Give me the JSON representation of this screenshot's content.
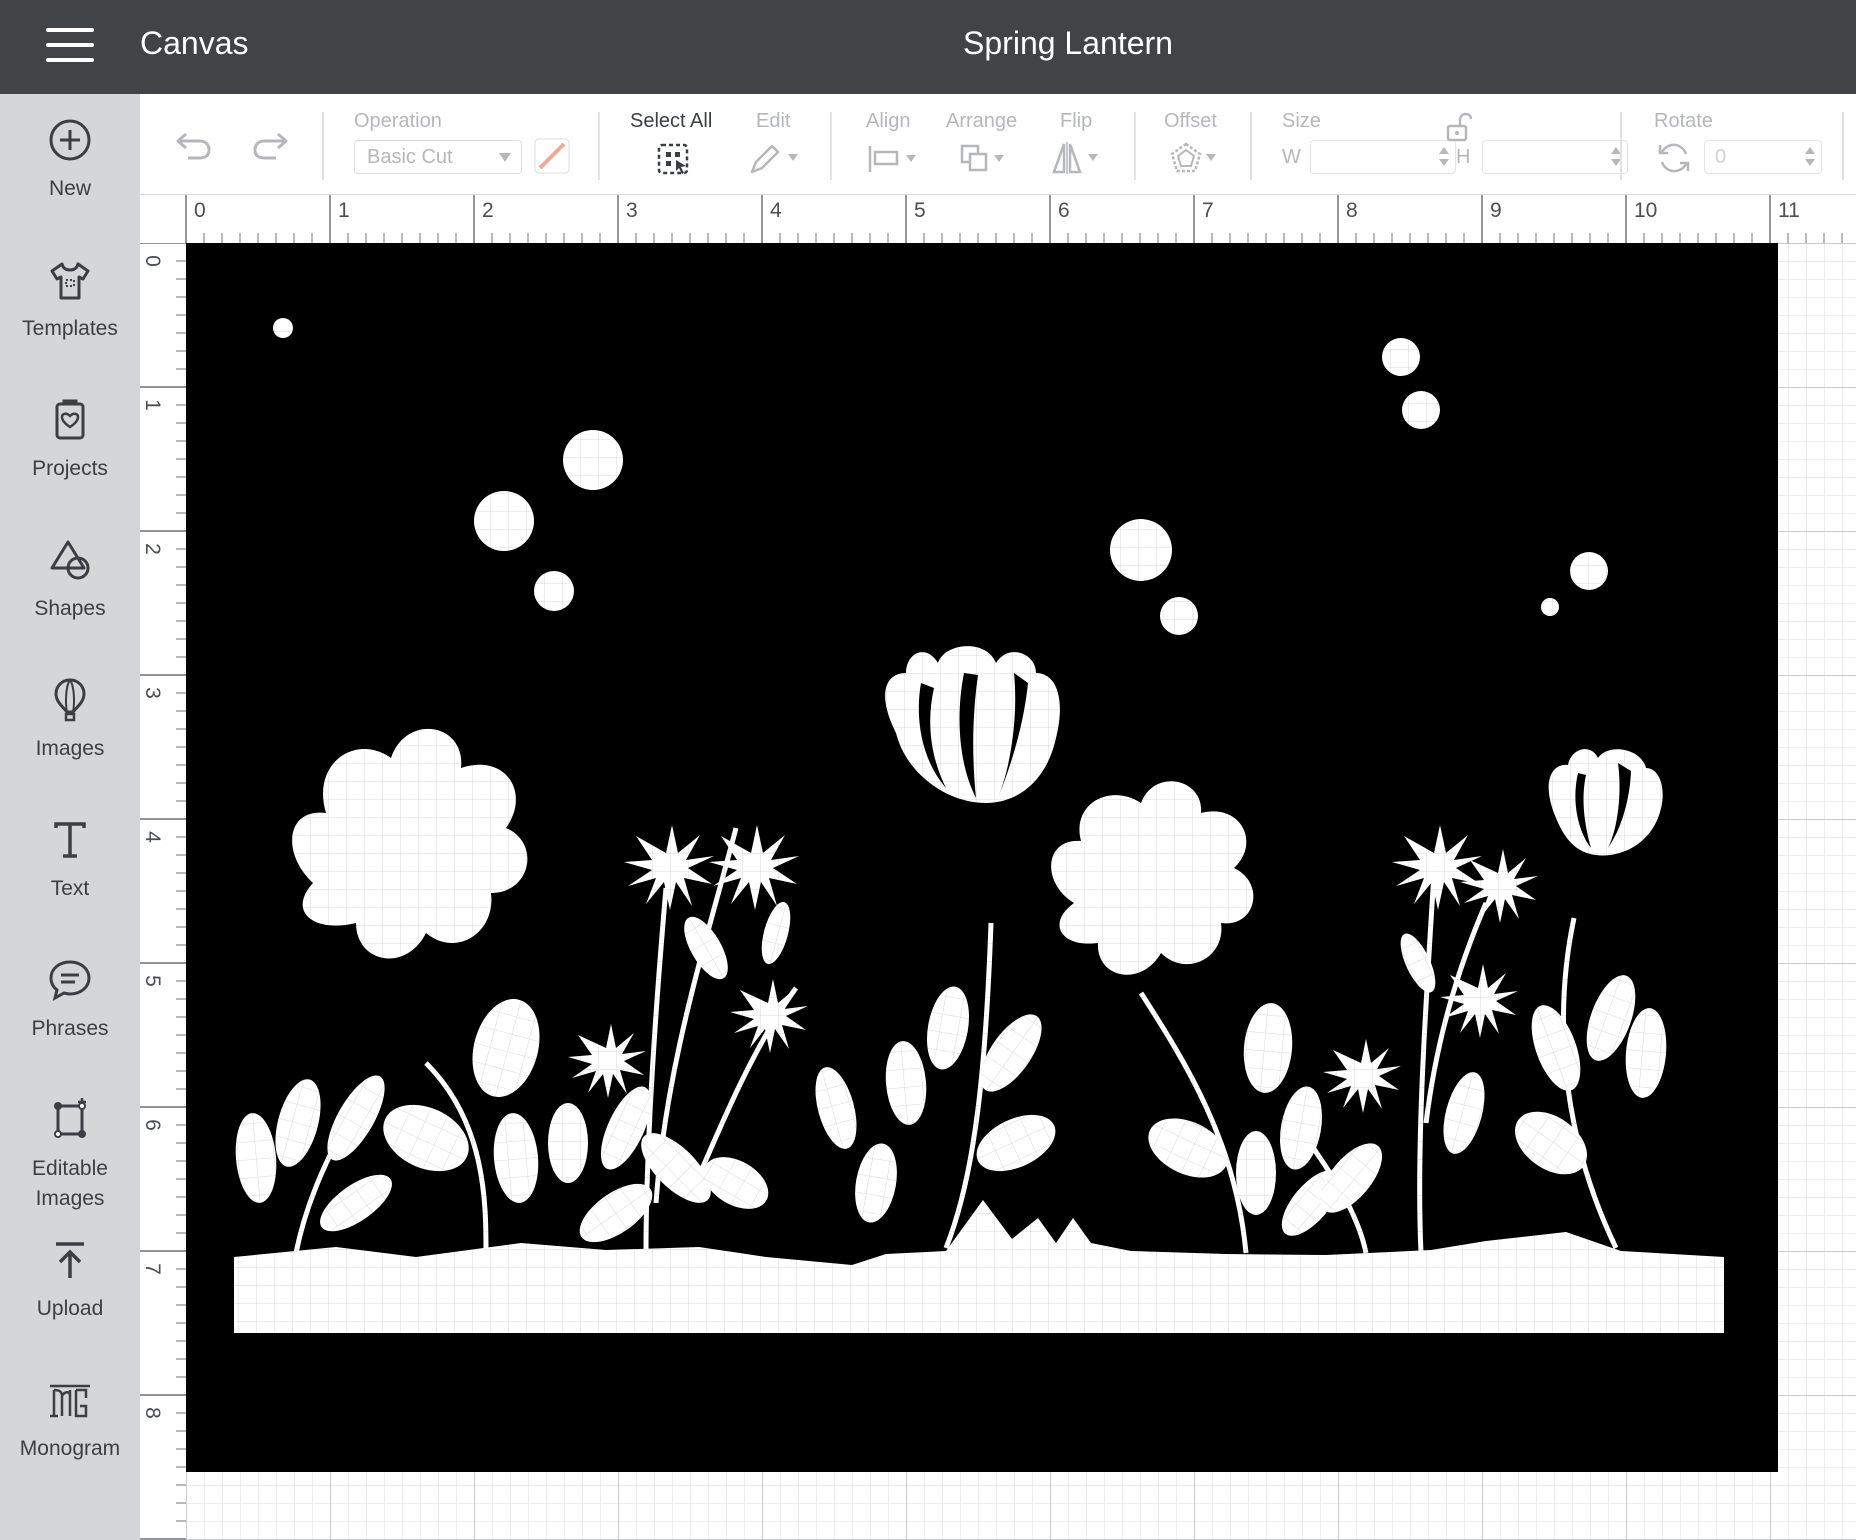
{
  "header": {
    "app_title": "Canvas",
    "project_title": "Spring Lantern"
  },
  "sidebar": {
    "items": [
      {
        "label": "New",
        "icon": "plus-circle-icon"
      },
      {
        "label": "Templates",
        "icon": "shirt-icon"
      },
      {
        "label": "Projects",
        "icon": "heart-clipboard-icon"
      },
      {
        "label": "Shapes",
        "icon": "shapes-icon"
      },
      {
        "label": "Images",
        "icon": "hot-air-balloon-icon"
      },
      {
        "label": "Text",
        "icon": "text-t-icon"
      },
      {
        "label": "Phrases",
        "icon": "speech-bubble-icon"
      },
      {
        "label": "Editable\nImages",
        "icon": "editable-image-icon"
      },
      {
        "label": "Upload",
        "icon": "upload-arrow-icon"
      },
      {
        "label": "Monogram",
        "icon": "monogram-icon"
      }
    ]
  },
  "toolbar": {
    "operation_label": "Operation",
    "operation_value": "Basic Cut",
    "select_all_label": "Select All",
    "edit_label": "Edit",
    "align_label": "Align",
    "arrange_label": "Arrange",
    "flip_label": "Flip",
    "offset_label": "Offset",
    "size_label": "Size",
    "width_label": "W",
    "height_label": "H",
    "rotate_label": "Rotate",
    "rotate_value": "0"
  },
  "rulers": {
    "horizontal": [
      "0",
      "1",
      "2",
      "3",
      "4",
      "5",
      "6",
      "7",
      "8",
      "9",
      "10",
      "11"
    ],
    "vertical": [
      "0",
      "1",
      "2",
      "3",
      "4",
      "5",
      "6",
      "7",
      "8"
    ]
  },
  "canvas": {
    "design_name": "Spring Lantern",
    "design_fill": "#000000",
    "unit": "inch"
  }
}
